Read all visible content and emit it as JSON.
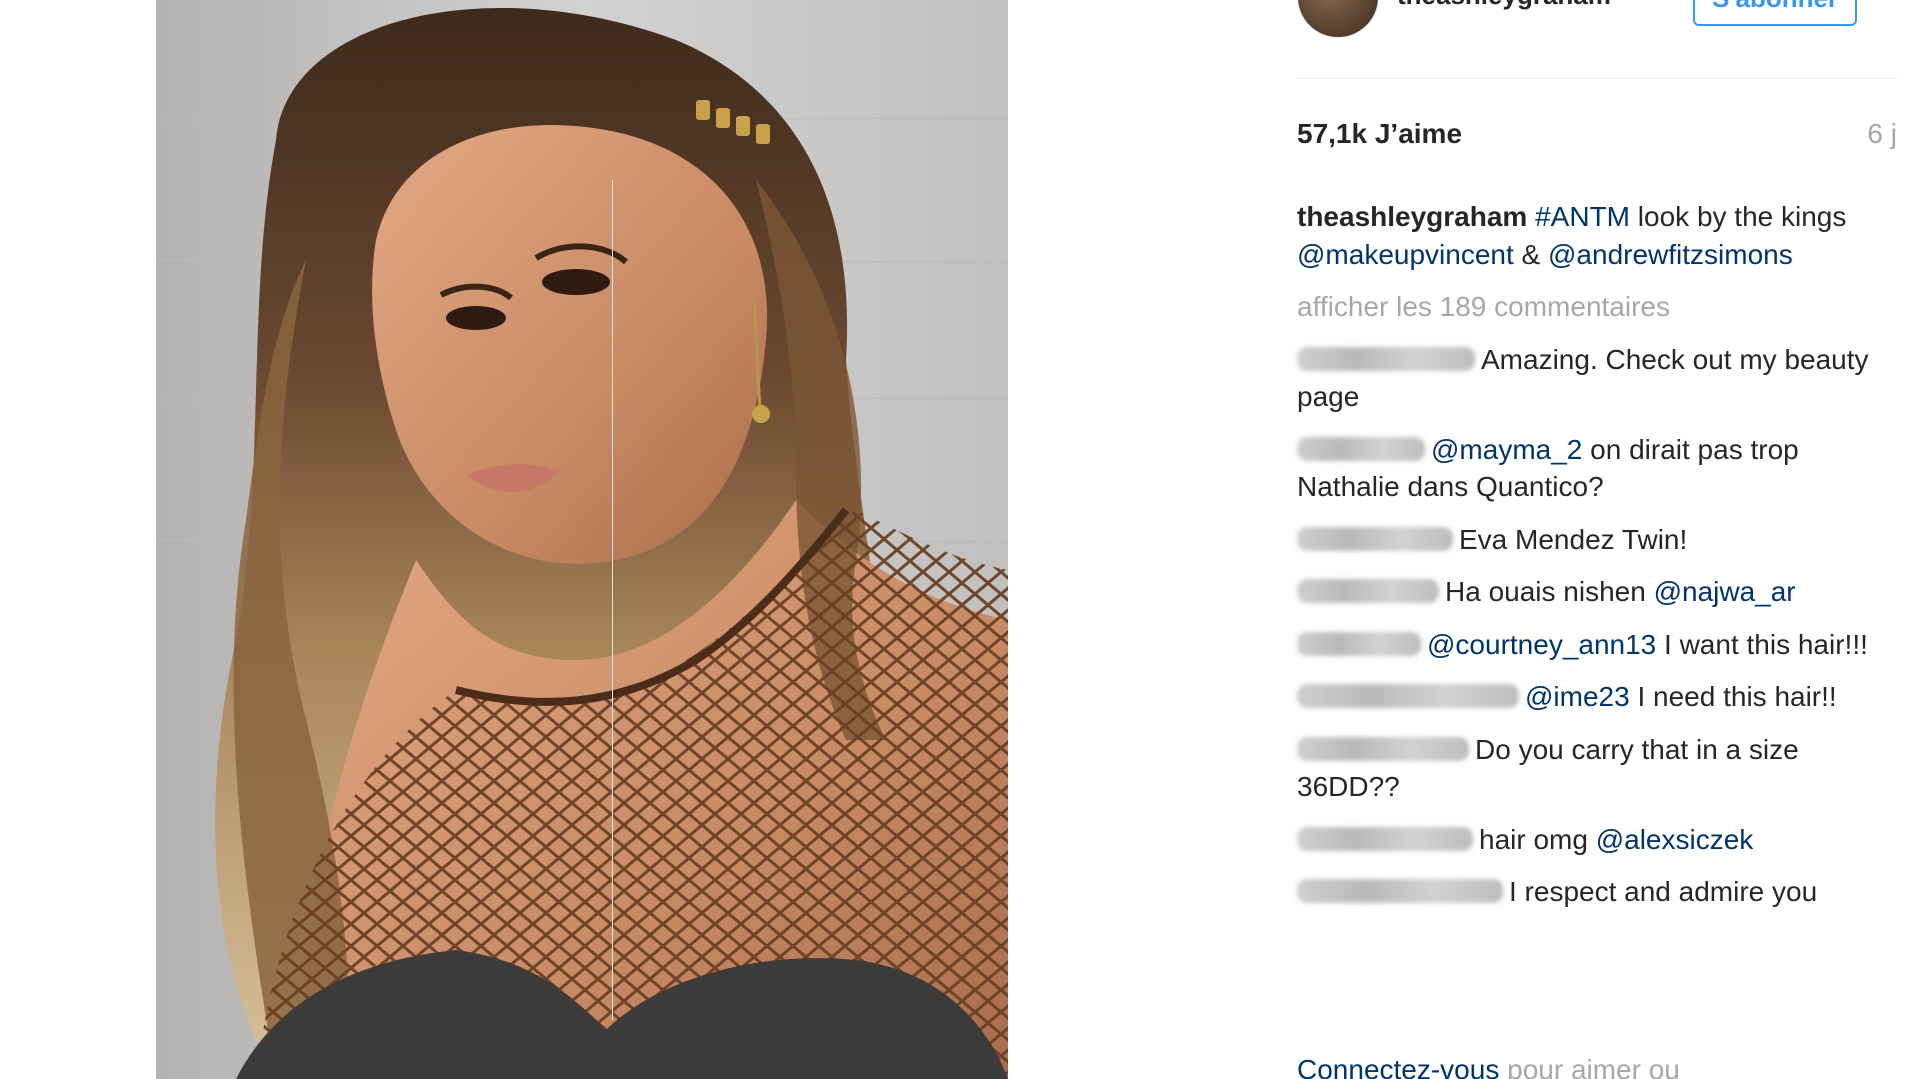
{
  "post": {
    "username": "theashleygraham",
    "follow_label": "S'abonner",
    "likes": "57,1k J’aime",
    "time_ago": "6 j",
    "caption": {
      "user": "theashleygraham",
      "hashtag": "#ANTM",
      "text_1": " look by the kings ",
      "mention_1": "@makeupvincent",
      "text_2": " & ",
      "mention_2": "@andrewfitzsimons"
    },
    "view_all_comments": "afficher les 189 commentaires"
  },
  "comments": [
    {
      "text": "Amazing. Check out my beauty page"
    },
    {
      "mention": "@mayma_2",
      "text": " on dirait pas trop Nathalie dans Quantico?"
    },
    {
      "text": "Eva Mendez Twin!"
    },
    {
      "text": "Ha ouais nishen ",
      "mention_after": "@najwa_ar"
    },
    {
      "mention": "@courtney_ann13",
      "text": " I want this hair!!!"
    },
    {
      "mention": "@ime23",
      "text": " I need this hair!!"
    },
    {
      "text": "Do you carry that in a size 36DD??"
    },
    {
      "text": "hair omg ",
      "mention_after": "@alexsiczek"
    },
    {
      "text": "I respect and admire you"
    }
  ],
  "footer": {
    "login_link": "Connectez-vous",
    "login_rest": " pour aimer ou"
  },
  "colors": {
    "link": "#003569",
    "accent_blue": "#3897f0",
    "muted": "#a5a7aa",
    "text": "#262626"
  },
  "icons": {
    "avatar": "profile-avatar"
  }
}
